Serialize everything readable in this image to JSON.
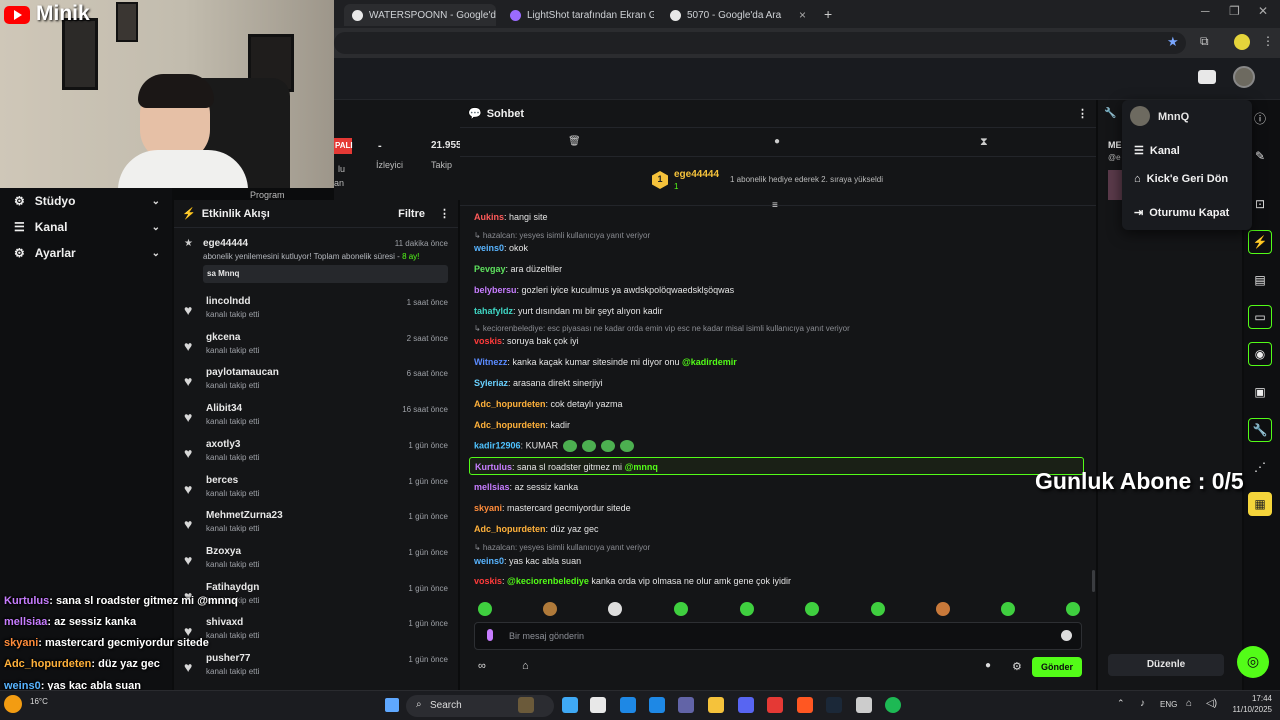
{
  "browser": {
    "tabs": [
      {
        "title": "WATERSPOONN - Google'da Ar",
        "favicon_color": "#e8e8e8"
      },
      {
        "title": "LightShot tarafından Ekran Gön",
        "favicon_color": "#9b6bff"
      },
      {
        "title": "5070 - Google'da Ara",
        "favicon_color": "#e8e8e8"
      }
    ],
    "new_tab": "+"
  },
  "overlay": {
    "brand": "Minik",
    "subscriber_goal": "Gunluk Abone : 0/5"
  },
  "sidebar": {
    "items": [
      {
        "label": "Stüdyo",
        "icon": "studio-icon"
      },
      {
        "label": "Kanal",
        "icon": "channel-icon"
      },
      {
        "label": "Ayarlar",
        "icon": "settings-icon"
      }
    ]
  },
  "stats": {
    "badge": "PALI",
    "viewers_value": "-",
    "viewers_label": "İzleyici",
    "followers_value": "21.955",
    "followers_label": "Takip",
    "partial_1": "lu",
    "partial_2": "an",
    "partial_3": "Program"
  },
  "activity": {
    "title": "Etkinlik Akışı",
    "filter": "Filtre",
    "first": {
      "name": "ege44444",
      "time": "11 dakika önce",
      "text_pre": "abonelik yenilemesini kutluyor! Toplam abonelik süresi - ",
      "text_hl": "8 ay!",
      "message": "sa Mnnq"
    },
    "items": [
      {
        "name": "lincolndd",
        "action": "kanalı takip etti",
        "time": "1 saat önce"
      },
      {
        "name": "gkcena",
        "action": "kanalı takip etti",
        "time": "2 saat önce"
      },
      {
        "name": "paylotamaucan",
        "action": "kanalı takip etti",
        "time": "6 saat önce"
      },
      {
        "name": "Alibit34",
        "action": "kanalı takip etti",
        "time": "16 saat önce"
      },
      {
        "name": "axotly3",
        "action": "kanalı takip etti",
        "time": "1 gün önce"
      },
      {
        "name": "berces",
        "action": "kanalı takip etti",
        "time": "1 gün önce"
      },
      {
        "name": "MehmetZurna23",
        "action": "kanalı takip etti",
        "time": "1 gün önce"
      },
      {
        "name": "Bzoxya",
        "action": "kanalı takip etti",
        "time": "1 gün önce"
      },
      {
        "name": "Fatihaydgn",
        "action": "kanalı takip etti",
        "time": "1 gün önce"
      },
      {
        "name": "shivaxd",
        "action": "kanalı takip etti",
        "time": "1 gün önce"
      },
      {
        "name": "pusher77",
        "action": "kanalı takip etti",
        "time": "1 gün önce"
      }
    ]
  },
  "chat": {
    "title": "Sohbet",
    "pinned": {
      "user": "ege44444",
      "count": "1",
      "text": "1 abonelik hediye ederek 2. sıraya yükseldi"
    },
    "messages": [
      {
        "type": "msg",
        "user": "Aukins",
        "color": "#ff5a5a",
        "text": "hangi site"
      },
      {
        "type": "reply",
        "text": "hazalcan: yesyes isimli kullanıcıya yanıt veriyor"
      },
      {
        "type": "msg",
        "user": "weins0",
        "color": "#58b4ff",
        "text": "okok"
      },
      {
        "type": "msg",
        "user": "Pevgay",
        "color": "#5ee25e",
        "text": "ara düzeltiler"
      },
      {
        "type": "msg",
        "user": "belybersu",
        "color": "#c77dff",
        "text": "gozleri iyice kuculmus ya awdskpolöqwaedsklşöqwas"
      },
      {
        "type": "msg",
        "user": "tahafyldz",
        "color": "#3fd6c4",
        "text": "yurt dısından mı bir şeyt alıyon kadir"
      },
      {
        "type": "reply",
        "text": "keciorenbelediye: esc piyasası ne kadar orda emin vip esc ne kadar misal isimli kullanıcıya yanıt veriyor"
      },
      {
        "type": "msg",
        "user": "voskis",
        "color": "#ff3b3b",
        "text": "soruya bak çok iyi"
      },
      {
        "type": "msg",
        "user": "Witnezz",
        "color": "#5a8bff",
        "text": "kanka kaçak kumar sitesinde mi diyor onu ",
        "mention": "@kadirdemir"
      },
      {
        "type": "msg",
        "user": "Syleriaz",
        "color": "#6ad1ff",
        "text": "arasana direkt sinerjiyi"
      },
      {
        "type": "msg",
        "user": "Adc_hopurdeten",
        "color": "#ffb13b",
        "text": "cok detaylı yazma"
      },
      {
        "type": "msg",
        "user": "Adc_hopurdeten",
        "color": "#ffb13b",
        "text": "kadir"
      },
      {
        "type": "msg",
        "user": "kadir12906",
        "color": "#4fc3ff",
        "text": "KUMAR"
      },
      {
        "type": "highlight",
        "user": "Kurtulus",
        "color": "#c77dff",
        "text": "sana sl roadster gitmez mi ",
        "mention": "@mnnq"
      },
      {
        "type": "msg",
        "user": "mellsias",
        "color": "#c77dff",
        "text": "az sessiz kanka"
      },
      {
        "type": "msg",
        "user": "skyani",
        "color": "#ff8c3b",
        "text": "mastercard gecmiyordur sitede"
      },
      {
        "type": "msg",
        "user": "Adc_hopurdeten",
        "color": "#ffb13b",
        "text": "düz yaz gec"
      },
      {
        "type": "reply",
        "text": "hazalcan: yesyes isimli kullanıcıya yanıt veriyor"
      },
      {
        "type": "msg",
        "user": "weins0",
        "color": "#58b4ff",
        "text": "yas kac abla suan"
      },
      {
        "type": "msg",
        "user": "voskis",
        "color": "#ff3b3b",
        "text": "",
        "mention": "@keciorenbelediye",
        "text_after": " kanka orda vip olmasa ne olur amk gene çok iyidir"
      }
    ],
    "input_placeholder": "Bir mesaj gönderin",
    "send_label": "Gönder"
  },
  "user_menu": {
    "username": "MnnQ",
    "items": [
      "Kanal",
      "Kick'e Geri Dön",
      "Oturumu Kapat"
    ]
  },
  "right_panel": {
    "partial_1": "ME",
    "partial_2": "@e",
    "edit_label": "Düzenle"
  },
  "stream_overlay_chat": [
    {
      "user": "Kurtulus",
      "color": "#c77dff",
      "text": "sana sl roadster gitmez mi @mnnq"
    },
    {
      "user": "mellsiaa",
      "color": "#c77dff",
      "text": "az sessiz kanka"
    },
    {
      "user": "skyani",
      "color": "#ff8c3b",
      "text": "mastercard gecmiyordur sitede"
    },
    {
      "user": "Adc_hopurdeten",
      "color": "#ffb13b",
      "text": "düz yaz gec"
    },
    {
      "user": "weins0",
      "color": "#58b4ff",
      "text": "yas kac abla suan"
    },
    {
      "user": "voskis",
      "color": "#ff3b3b",
      "text": "@keciorenbelediye kanka orda vip olmasa ne olur amk gene çok iyidir"
    }
  ],
  "taskbar": {
    "search": "Search",
    "weather": "16°C",
    "lang": "ENG",
    "time": "17:44",
    "date": "11/10/2025"
  },
  "colors": {
    "accent": "#53fc18",
    "bg": "#0b0c0d",
    "panel": "#141517"
  }
}
